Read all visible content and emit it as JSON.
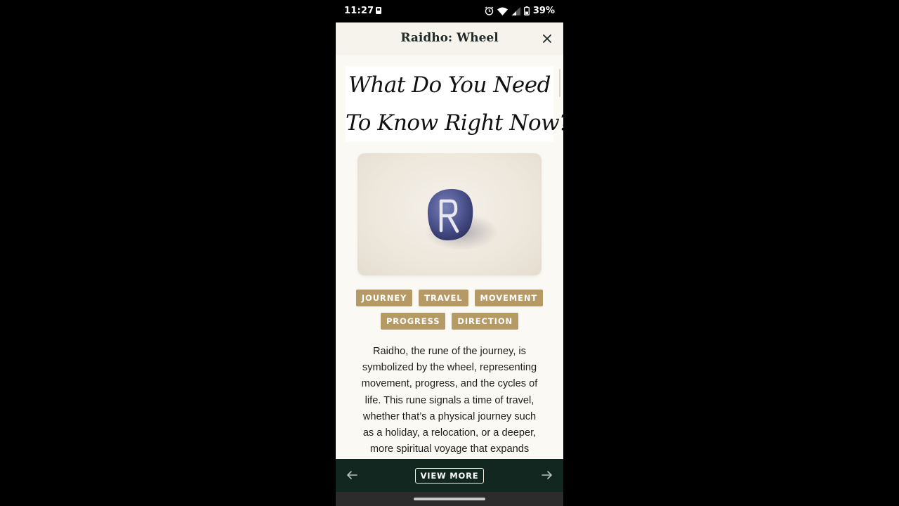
{
  "status_bar": {
    "time": "11:27",
    "battery": "39%",
    "icons": [
      "notification-icon",
      "alarm-icon",
      "wifi-icon",
      "signal-icon",
      "battery-icon"
    ]
  },
  "header": {
    "title": "Raidho: Wheel",
    "close_icon": "close-icon"
  },
  "hero": {
    "line1": "What Do You Need",
    "line2": "To Know Right Now?"
  },
  "rune_image": {
    "symbol": "R",
    "stone_color": "#4f5691"
  },
  "tags": {
    "row1": [
      "JOURNEY",
      "TRAVEL",
      "MOVEMENT"
    ],
    "row2": [
      "PROGRESS",
      "DIRECTION"
    ],
    "color": "#b59a66"
  },
  "body": {
    "lines": [
      "Raidho, the rune of the journey, is",
      "symbolized by the wheel, representing",
      "movement, progress, and the cycles of",
      "life. This rune signals a time of travel,",
      "whether that’s a physical journey such",
      "as a holiday, a relocation, or a deeper,",
      "more spiritual voyage that expands"
    ]
  },
  "bottom_nav": {
    "view_more_label": "VIEW MORE",
    "prev_icon": "arrow-left-icon",
    "next_icon": "arrow-right-icon",
    "background": "#12271f"
  }
}
